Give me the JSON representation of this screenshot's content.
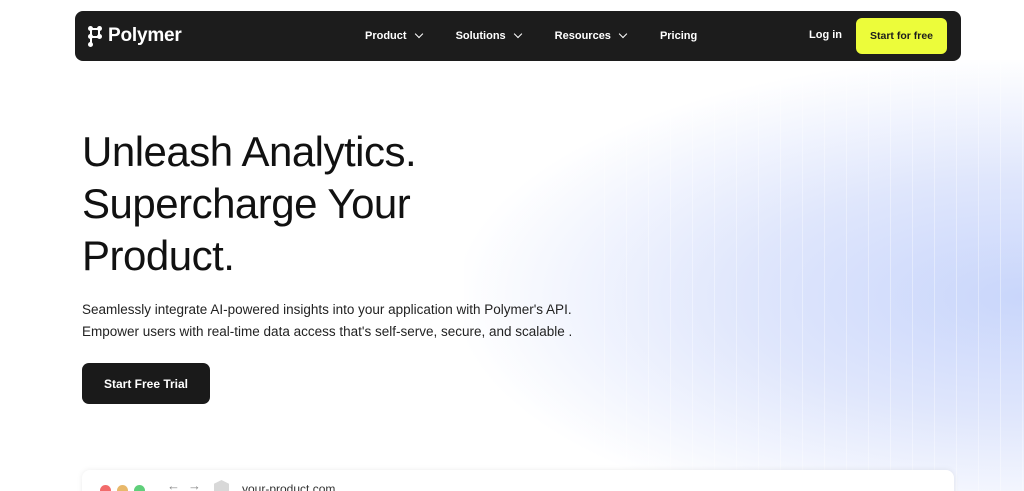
{
  "brand": {
    "name": "Polymer",
    "logo_icon": "polymer-logo-icon"
  },
  "nav": {
    "items": [
      {
        "label": "Product",
        "has_dropdown": true
      },
      {
        "label": "Solutions",
        "has_dropdown": true
      },
      {
        "label": "Resources",
        "has_dropdown": true
      },
      {
        "label": "Pricing",
        "has_dropdown": false
      }
    ],
    "login_label": "Log in",
    "cta_label": "Start for free"
  },
  "hero": {
    "title_lines": [
      "Unleash Analytics.",
      "Supercharge Your",
      "Product."
    ],
    "subtitle_lines": [
      "Seamlessly integrate AI-powered insights into your application with Polymer's API.",
      "Empower users with real-time data access that's self-serve, secure, and scalable ."
    ],
    "cta_label": "Start Free Trial"
  },
  "browser_preview": {
    "url": "your-product.com",
    "dot_colors": [
      "#f26b6b",
      "#e8b86a",
      "#5fcf7a"
    ]
  },
  "colors": {
    "nav_bg": "#1c1c1c",
    "accent": "#ecfc3a",
    "text_dark": "#111111",
    "glow": "#c9d6fb"
  }
}
